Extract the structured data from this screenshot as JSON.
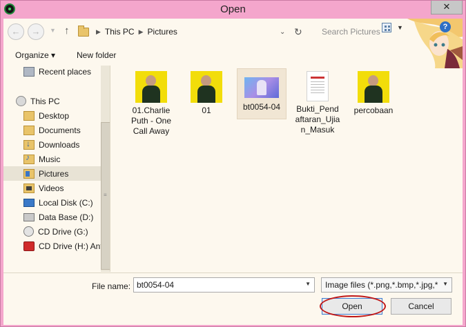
{
  "window": {
    "title": "Open",
    "close_glyph": "✕"
  },
  "nav": {
    "back_glyph": "←",
    "forward_glyph": "→",
    "up_glyph": "↑",
    "breadcrumb": [
      "This PC",
      "Pictures"
    ],
    "search_placeholder": "Search Pictures"
  },
  "toolbar": {
    "organize_label": "Organize ▾",
    "new_folder_label": "New folder"
  },
  "sidebar": {
    "items": [
      {
        "label": "Recent places",
        "icon": "recent-places-icon"
      },
      {
        "label": "This PC",
        "icon": "computer-icon"
      },
      {
        "label": "Desktop",
        "icon": "folder-icon"
      },
      {
        "label": "Documents",
        "icon": "folder-icon"
      },
      {
        "label": "Downloads",
        "icon": "downloads-icon"
      },
      {
        "label": "Music",
        "icon": "music-icon"
      },
      {
        "label": "Pictures",
        "icon": "pictures-icon"
      },
      {
        "label": "Videos",
        "icon": "videos-icon"
      },
      {
        "label": "Local Disk (C:)",
        "icon": "disk-icon"
      },
      {
        "label": "Data Base (D:)",
        "icon": "disk-icon"
      },
      {
        "label": "CD Drive (G:)",
        "icon": "cd-icon"
      },
      {
        "label": "CD Drive (H:) Ant",
        "icon": "cd-icon"
      }
    ]
  },
  "files": [
    {
      "name": "01.Charlie Puth - One Call Away",
      "type": "image"
    },
    {
      "name": "01",
      "type": "image"
    },
    {
      "name": "bt0054-04",
      "type": "image"
    },
    {
      "name": "Bukti_Pendaftaran_Ujian_Masuk",
      "type": "document"
    },
    {
      "name": "percobaan",
      "type": "image"
    }
  ],
  "file_name_lines": {
    "f0": [
      "01.Charlie",
      "Puth - One",
      "Call Away"
    ],
    "f3": [
      "Bukti_Pend",
      "aftaran_Ujia",
      "n_Masuk"
    ]
  },
  "footer": {
    "file_name_label": "File name:",
    "file_name_value": "bt0054-04",
    "file_type_value": "Image files (*.png,*.bmp,*.jpg,*",
    "open_label": "Open",
    "cancel_label": "Cancel"
  },
  "colors": {
    "window_frame": "#f4a6cc",
    "client_bg": "#fdf8ee",
    "annotation_oval": "#c01818"
  }
}
